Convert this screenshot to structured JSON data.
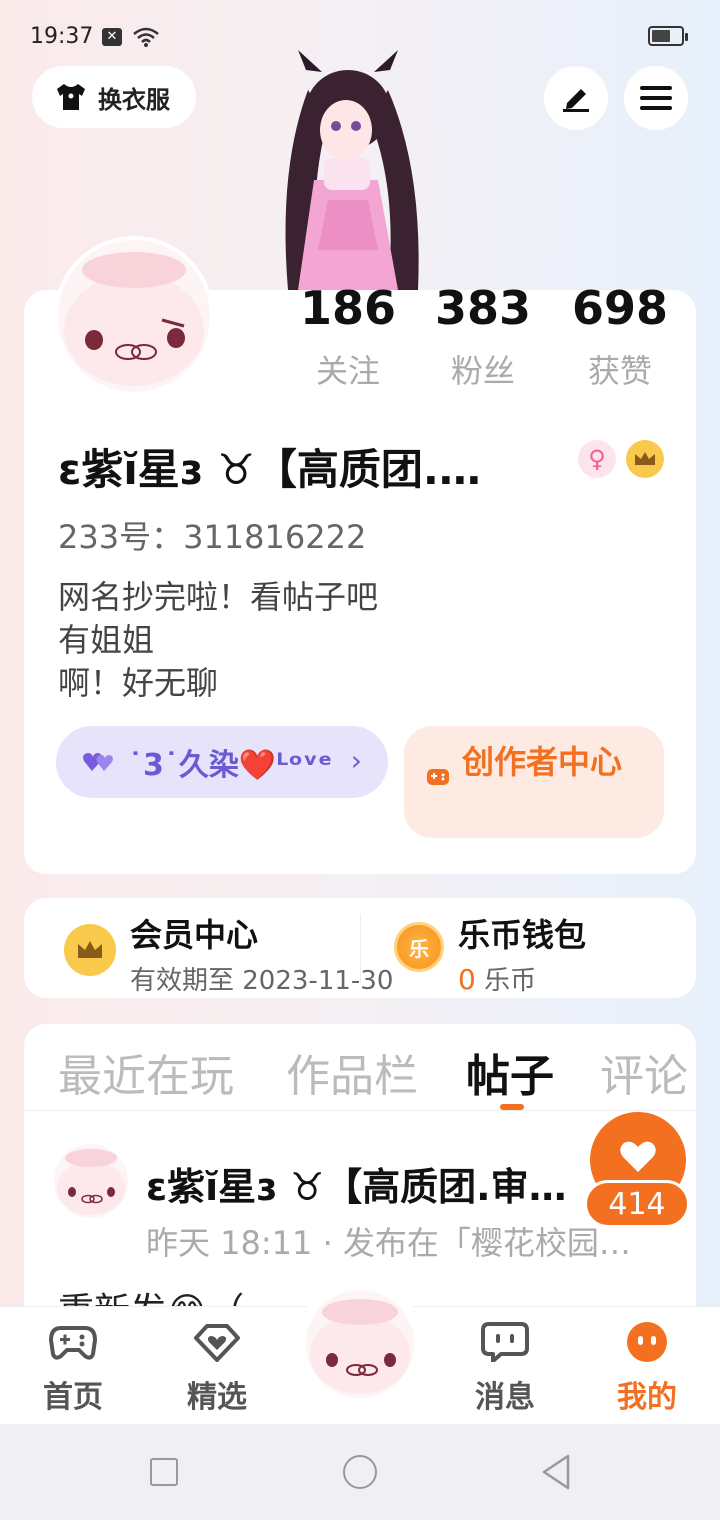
{
  "status": {
    "time": "19:37"
  },
  "header": {
    "outfit_label": "换衣服"
  },
  "profile": {
    "stats": [
      {
        "value": "186",
        "label": "关注"
      },
      {
        "value": "383",
        "label": "粉丝"
      },
      {
        "value": "698",
        "label": "获赞"
      }
    ],
    "username": "ɛ紫ĭ星ɜ ♉【高质团.…",
    "uid": "233号：311816222",
    "bio": [
      "网名抄完啦！看帖子吧",
      "有姐姐",
      "啊！好无聊"
    ],
    "group_label": "˙3˙久染❤️ᴸᵒᵛᵉ",
    "creator_center_label": "创作者中心"
  },
  "membership": {
    "title": "会员中心",
    "subtitle": "有效期至 2023-11-30"
  },
  "wallet": {
    "title": "乐币钱包",
    "amount": "0",
    "unit": "乐币",
    "coin_glyph": "乐"
  },
  "tabs": [
    {
      "label": "最近在玩",
      "active": false
    },
    {
      "label": "作品栏",
      "active": false
    },
    {
      "label": "帖子",
      "active": true
    },
    {
      "label": "评论",
      "active": false
    }
  ],
  "post": {
    "author": "ɛ紫ĭ星ɜ ♉【高质团.审…",
    "meta": "昨天 18:11 · 发布在「樱花校园…",
    "text_preview": "重新发😂（"
  },
  "like": {
    "count": "414"
  },
  "bottom_nav": [
    {
      "label": "首页",
      "icon": "gamepad-icon",
      "active": false
    },
    {
      "label": "精选",
      "icon": "heart-diamond-icon",
      "active": false
    },
    {
      "label": "消息",
      "icon": "chat-bubble-icon",
      "active": false
    },
    {
      "label": "我的",
      "icon": "smiley-icon",
      "active": true
    }
  ],
  "colors": {
    "accent": "#f37021",
    "purple": "#6a5ad6",
    "gold": "#f9c94c"
  }
}
